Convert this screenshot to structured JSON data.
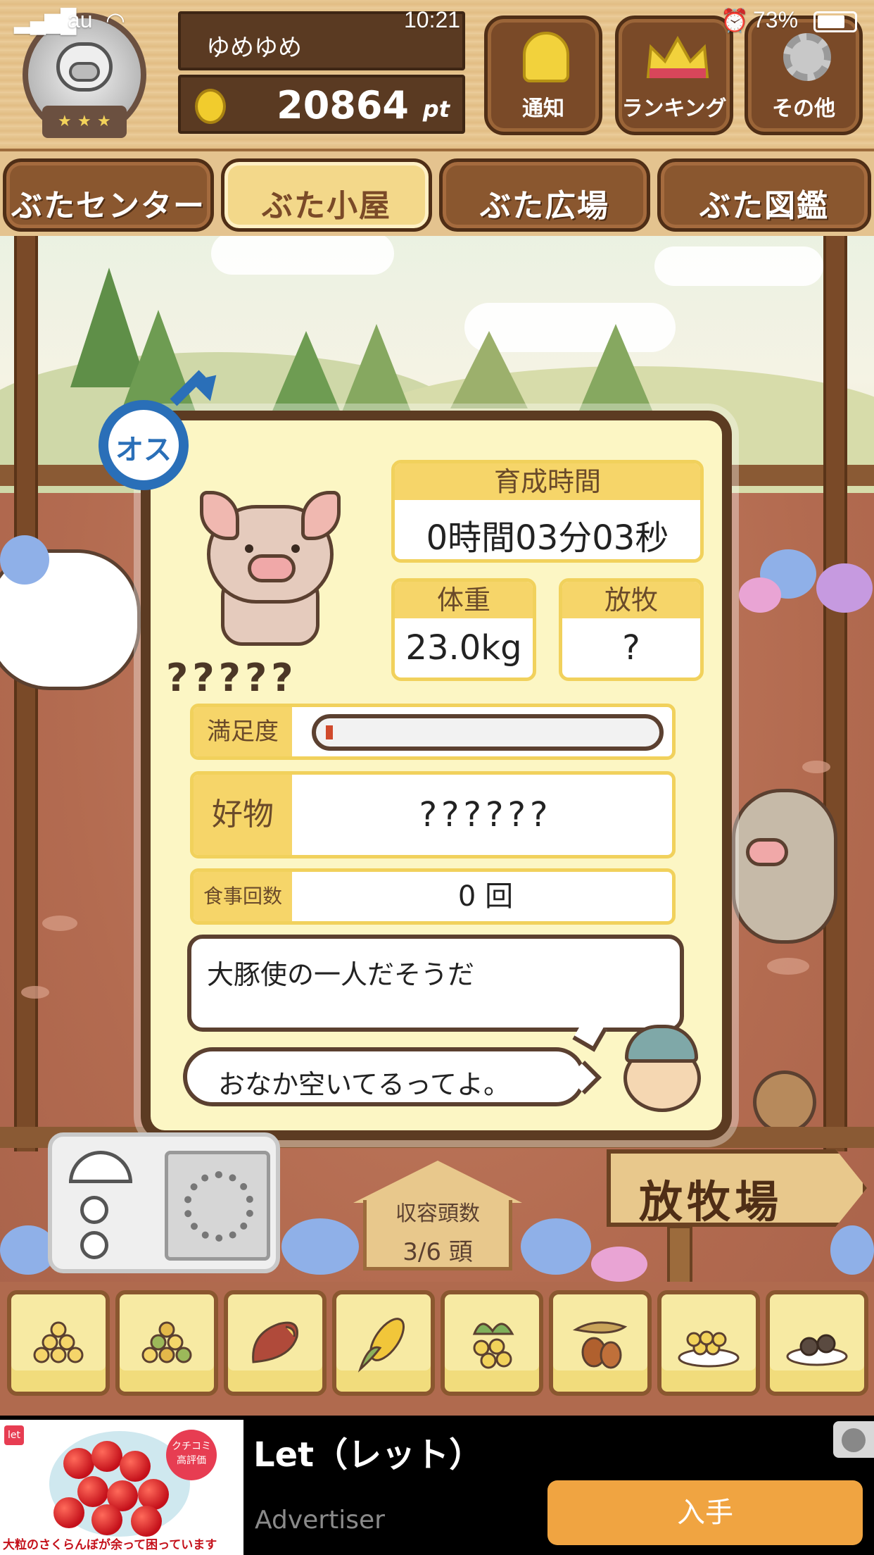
{
  "status_bar": {
    "carrier": "au",
    "time": "10:21",
    "battery": "73%"
  },
  "header": {
    "username": "ゆめゆめ",
    "points": "20864",
    "points_unit": "pt",
    "buttons": {
      "notify": "通知",
      "ranking": "ランキング",
      "other": "その他"
    }
  },
  "tabs": [
    {
      "label": "ぶたセンター",
      "active": false
    },
    {
      "label": "ぶた小屋",
      "active": true
    },
    {
      "label": "ぶた広場",
      "active": false
    },
    {
      "label": "ぶた図鑑",
      "active": false
    }
  ],
  "pig_card": {
    "gender_label": "オス",
    "name": "?????",
    "growth_time": {
      "label": "育成時間",
      "value": "0時間03分03秒"
    },
    "weight": {
      "label": "体重",
      "value": "23.0kg"
    },
    "grazing": {
      "label": "放牧",
      "value": "?"
    },
    "satisfaction": {
      "label": "満足度",
      "level": 0.02
    },
    "favorite": {
      "label": "好物",
      "value": "??????"
    },
    "meals": {
      "label": "食事回数",
      "value": "0 回"
    },
    "description": "大豚使の一人だそうだ",
    "farmer_says": "おなか空いてるってよ。"
  },
  "capacity": {
    "label": "収容頭数",
    "value": "3/6 頭"
  },
  "pasture_sign": "放牧場",
  "foods": [
    "grain-small-icon",
    "grain-mixed-icon",
    "sweet-potato-icon",
    "corn-icon",
    "berries-icon",
    "acorn-icon",
    "grain-plate-icon",
    "truffle-plate-icon"
  ],
  "ad": {
    "logo": "let",
    "stamp": "クチコミ 高評価",
    "image_caption": "大粒のさくらんぼが余って困っています",
    "title": "Let（レット）",
    "advertiser": "Advertiser",
    "cta": "入手"
  },
  "colors": {
    "gender_blue": "#2a6fb8",
    "card_bg": "#fcf6c4",
    "label_yellow": "#f6d569",
    "satisfaction_fill": "#d04a2c",
    "cta_orange": "#f0a441"
  }
}
